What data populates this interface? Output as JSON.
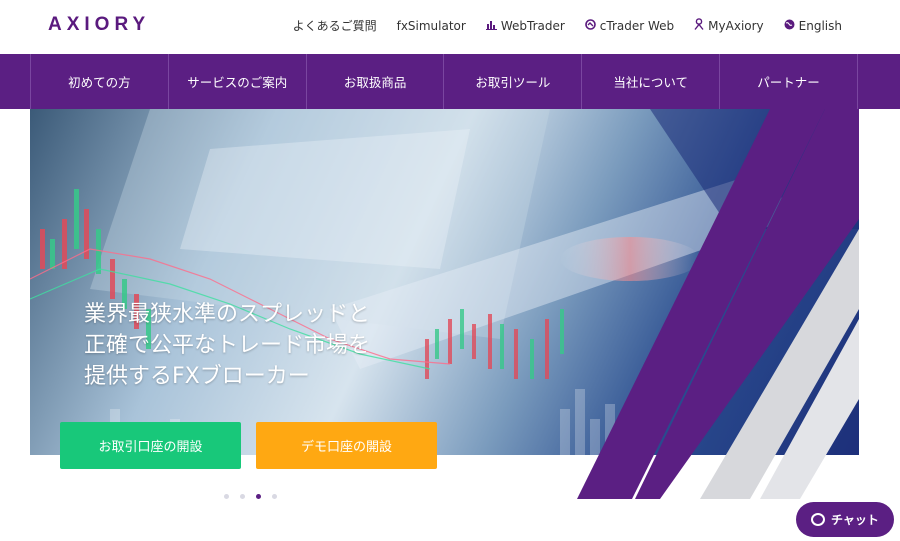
{
  "brand": {
    "logo": "AXIORY",
    "color": "#5b1f83"
  },
  "top_links": [
    {
      "label": "よくあるご質問",
      "icon": ""
    },
    {
      "label": "fxSimulator",
      "icon": ""
    },
    {
      "label": "WebTrader",
      "icon": "chart-icon"
    },
    {
      "label": "cTrader Web",
      "icon": "ctrader-icon"
    },
    {
      "label": "MyAxiory",
      "icon": "user-icon"
    },
    {
      "label": "English",
      "icon": "globe-icon"
    }
  ],
  "nav": [
    {
      "label": "初めての方"
    },
    {
      "label": "サービスのご案内"
    },
    {
      "label": "お取扱商品"
    },
    {
      "label": "お取引ツール"
    },
    {
      "label": "当社について"
    },
    {
      "label": "パートナー"
    }
  ],
  "hero": {
    "lines": [
      "業界最狭水準のスプレッドと",
      "正確で公平なトレード市場を",
      "提供するFXブローカー"
    ],
    "buttons": {
      "real": "お取引口座の開設",
      "demo": "デモ口座の開設"
    },
    "real_color": "#18c87a",
    "demo_color": "#ffa812"
  },
  "carousel": {
    "count": 4,
    "active_index": 2
  },
  "chat": {
    "label": "チャット"
  }
}
